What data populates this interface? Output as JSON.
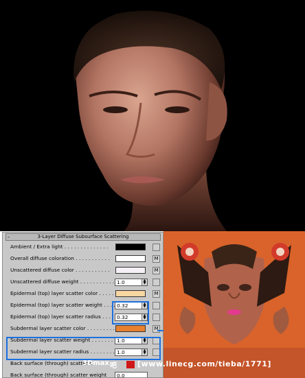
{
  "panel": {
    "title": "3-Layer Diffuse Subsurface Scattering",
    "collapse_symbol": "-",
    "rows": [
      {
        "label": "Ambient / Extra light . . . . . . . . . . . . . .",
        "kind": "color",
        "color": "#000000",
        "btn": ""
      },
      {
        "label": "Overall diffuse coloration . . . . . . . . . . .",
        "kind": "color",
        "color": "#ffffff",
        "btn": "M"
      },
      {
        "label": "Unscattered diffuse color . . . . . . . . . . .",
        "kind": "color",
        "color": "#f4f0f6",
        "btn": "M"
      },
      {
        "label": "Unscattered diffuse weight . . . . . . . . . . .",
        "kind": "spin",
        "value": "1.0",
        "btn": ""
      },
      {
        "label": "Epidermal (top) layer scatter color . . . . . .",
        "kind": "color",
        "color": "#f8d6a2",
        "btn": "M"
      },
      {
        "label": "Epidermal (top) layer scatter weight . . . . .",
        "kind": "spin",
        "value": "0.32",
        "btn": ""
      },
      {
        "label": "Epidermal (top) layer scatter radius . . . . .",
        "kind": "spin",
        "value": "0.32",
        "btn": ""
      },
      {
        "label": "Subdermal layer scatter color . . . . . . . . .",
        "kind": "color",
        "color": "#e8812f",
        "btn": "M"
      },
      {
        "label": "Subdermal layer scatter weight . . . . . . . .",
        "kind": "spin",
        "value": "1.0",
        "btn": ""
      },
      {
        "label": "Subdermal layer scatter radius . . . . . . . .",
        "kind": "spin",
        "value": "1.0",
        "btn": ""
      },
      {
        "label": "Back surface (through) scatter c",
        "kind": "none",
        "btn": ""
      },
      {
        "label": "Back surface (through) scatter weight",
        "kind": "spin",
        "value": "0.0",
        "btn": ""
      }
    ]
  },
  "watermark": {
    "prefix": "3Dmax",
    "mid": "吧",
    "url": "[www.linecg.com/tieba/1771]"
  },
  "colors": {
    "highlight": "#1b6fe0",
    "uv_background": "#d9632a"
  }
}
